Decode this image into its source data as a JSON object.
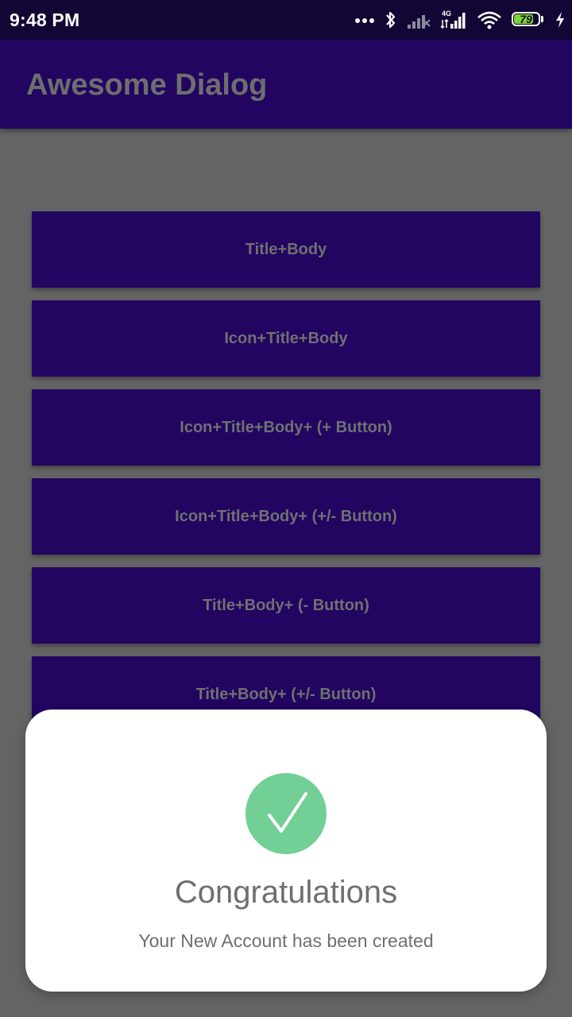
{
  "status_bar": {
    "time": "9:48 PM",
    "network_label": "4G",
    "battery_level": "79",
    "battery_fraction": 0.79,
    "icons": [
      "more-dots-icon",
      "bluetooth-icon",
      "signal-off-icon",
      "signal-4g-icon",
      "wifi-icon",
      "battery-icon",
      "charging-bolt-icon"
    ]
  },
  "app_bar": {
    "title": "Awesome Dialog"
  },
  "buttons": [
    {
      "label": "Title+Body"
    },
    {
      "label": "Icon+Title+Body"
    },
    {
      "label": "Icon+Title+Body+ (+ Button)"
    },
    {
      "label": "Icon+Title+Body+ (+/- Button)"
    },
    {
      "label": "Title+Body+ (- Button)"
    },
    {
      "label": "Title+Body+ (+/- Button)"
    },
    {
      "label": ""
    },
    {
      "label": ""
    }
  ],
  "dialog": {
    "icon": "checkmark-icon",
    "title": "Congratulations",
    "body": "Your New Account has been created"
  },
  "colors": {
    "background_dim": "#646464",
    "status_bar": "#120634",
    "app_bar": "#220561",
    "button": "#210561",
    "check_green": "#72cf95",
    "battery_green": "#7cd43a"
  }
}
